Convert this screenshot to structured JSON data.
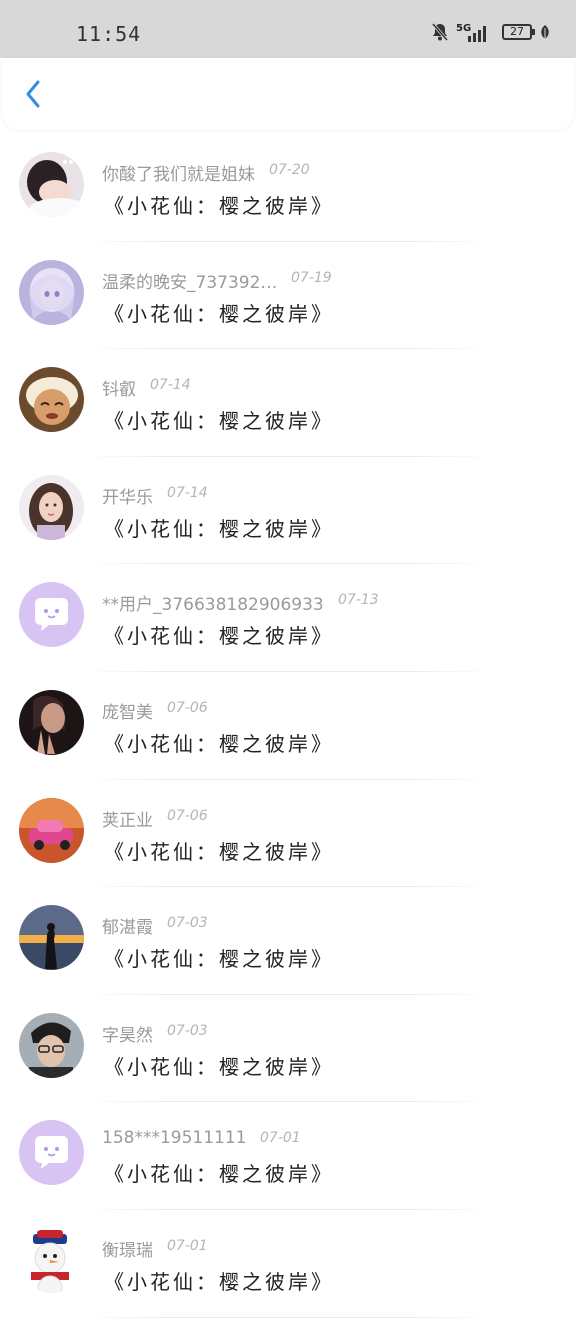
{
  "status_bar": {
    "time": "11:54",
    "network": "5G",
    "battery": "27"
  },
  "header": {
    "back_icon": "chevron-left-icon",
    "accent": "#2f8fe5"
  },
  "items": [
    {
      "name": "你酸了我们就是姐妹",
      "date": "07-20",
      "content": "《小花仙：樱之彼岸》",
      "avatar": "photo-girl-lying"
    },
    {
      "name": "温柔的晚安_737392…",
      "date": "07-19",
      "content": "《小花仙：樱之彼岸》",
      "avatar": "anime-girl"
    },
    {
      "name": "钭叡",
      "date": "07-14",
      "content": "《小花仙：樱之彼岸》",
      "avatar": "cartoon-character"
    },
    {
      "name": "开华乐",
      "date": "07-14",
      "content": "《小花仙：樱之彼岸》",
      "avatar": "photo-woman-portrait"
    },
    {
      "name": "**用户_376638182906933",
      "date": "07-13",
      "content": "《小花仙：樱之彼岸》",
      "avatar": "default-chat-bubble"
    },
    {
      "name": "庞智美",
      "date": "07-06",
      "content": "《小花仙：樱之彼岸》",
      "avatar": "photo-woman-praying"
    },
    {
      "name": "荚正业",
      "date": "07-06",
      "content": "《小花仙：樱之彼岸》",
      "avatar": "photo-pink-car"
    },
    {
      "name": "郁湛霞",
      "date": "07-03",
      "content": "《小花仙：樱之彼岸》",
      "avatar": "photo-sunset-silhouette"
    },
    {
      "name": "字昊然",
      "date": "07-03",
      "content": "《小花仙：樱之彼岸》",
      "avatar": "photo-man-glasses"
    },
    {
      "name": "158***19511111",
      "date": "07-01",
      "content": "《小花仙：樱之彼岸》",
      "avatar": "default-chat-bubble"
    },
    {
      "name": "衡璟瑞",
      "date": "07-01",
      "content": "《小花仙：樱之彼岸》",
      "avatar": "cartoon-snowman"
    }
  ]
}
